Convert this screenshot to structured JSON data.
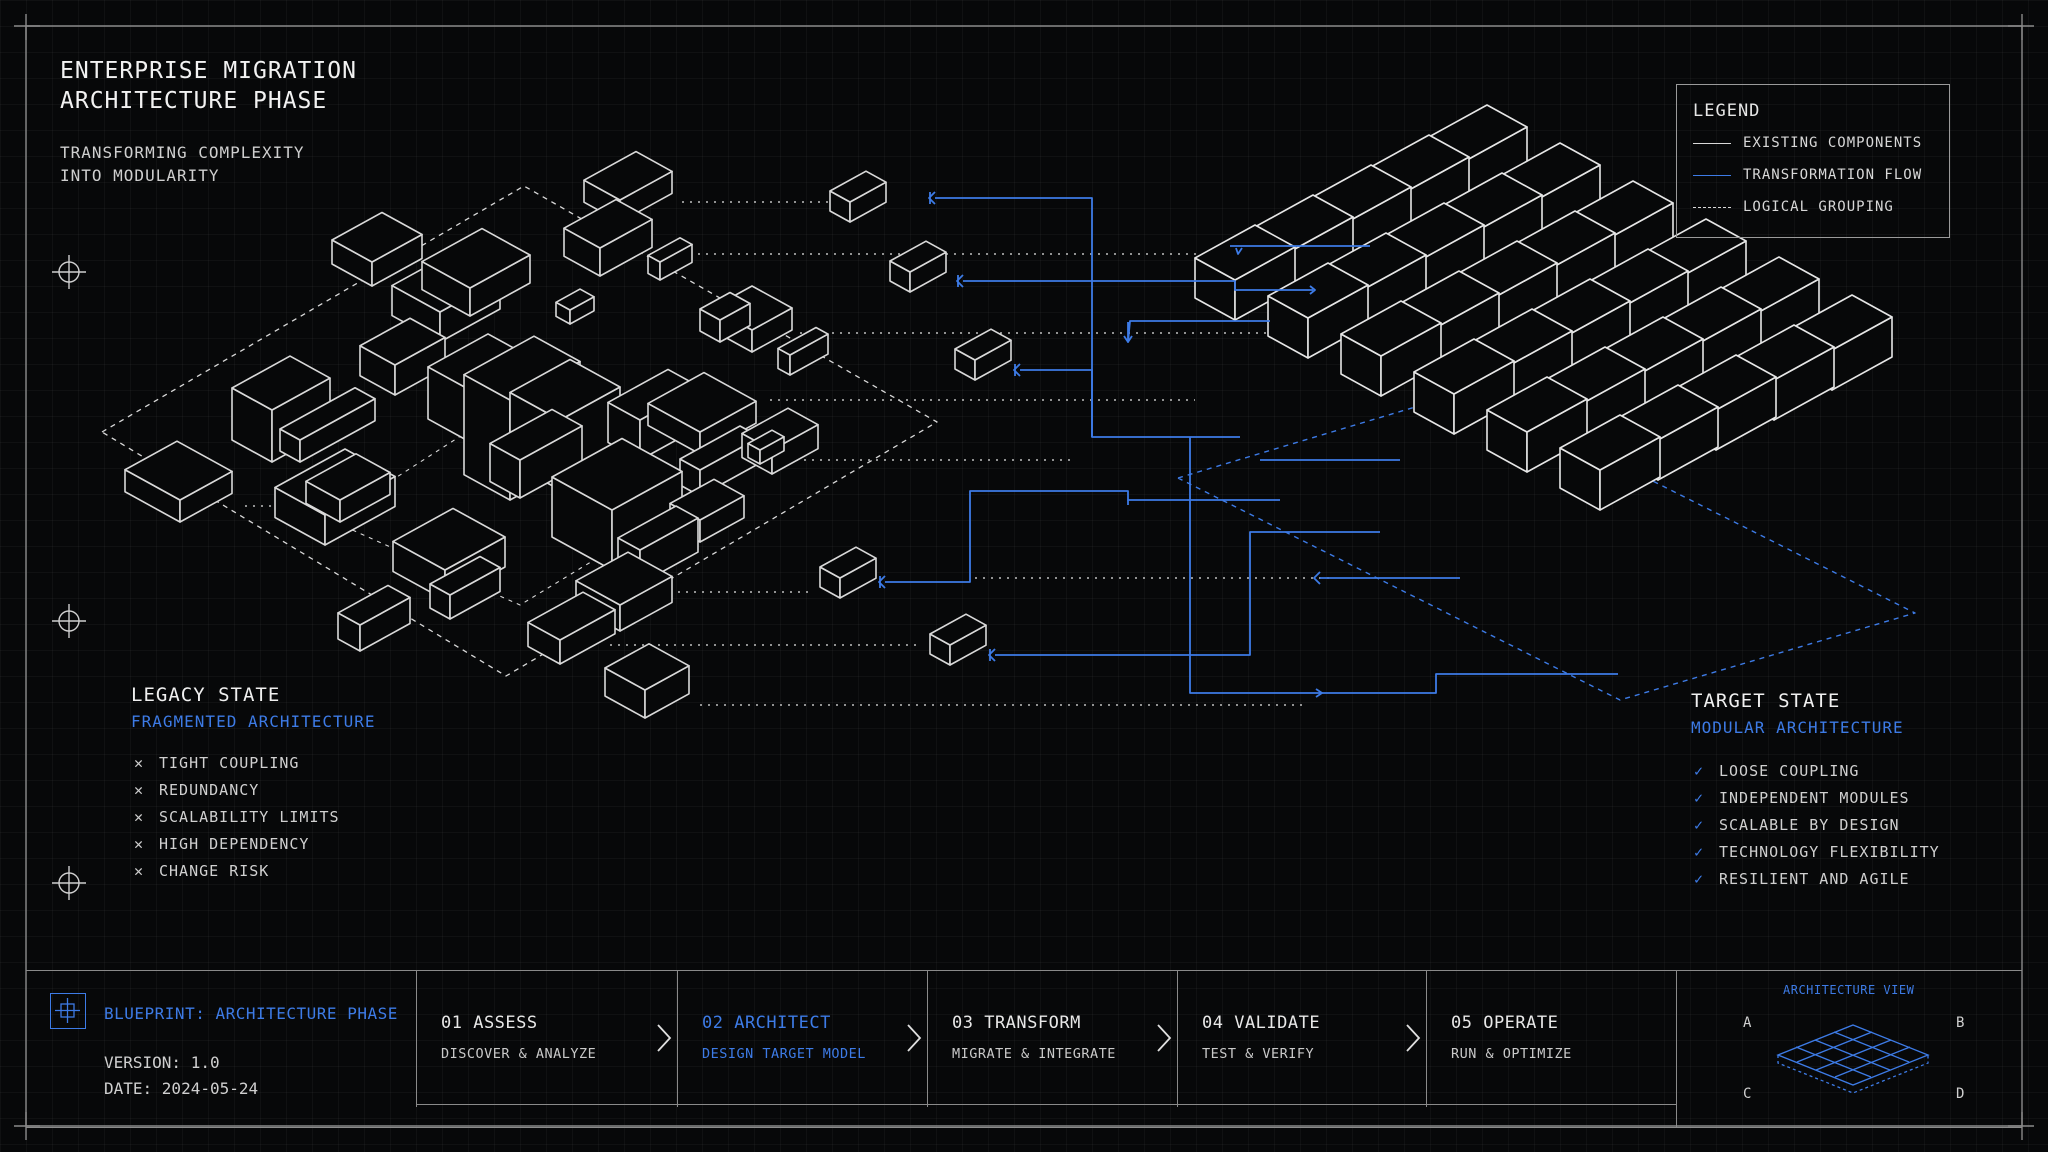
{
  "header": {
    "title_lines": [
      "ENTERPRISE MIGRATION",
      "ARCHITECTURE PHASE"
    ],
    "subtitle_lines": [
      "TRANSFORMING COMPLEXITY",
      "INTO MODULARITY"
    ]
  },
  "legend": {
    "title": "LEGEND",
    "items": [
      {
        "label": "EXISTING COMPONENTS",
        "style": "solid",
        "color": "#d9d9d9"
      },
      {
        "label": "TRANSFORMATION FLOW",
        "style": "solid",
        "color": "#3d7be6"
      },
      {
        "label": "LOGICAL GROUPING",
        "style": "dashed",
        "color": "#d9d9d9"
      }
    ]
  },
  "legacy": {
    "title": "LEGACY STATE",
    "subtitle": "FRAGMENTED ARCHITECTURE",
    "items": [
      "TIGHT COUPLING",
      "REDUNDANCY",
      "SCALABILITY LIMITS",
      "HIGH DEPENDENCY",
      "CHANGE RISK"
    ]
  },
  "target": {
    "title": "TARGET STATE",
    "subtitle": "MODULAR ARCHITECTURE",
    "items": [
      "LOOSE COUPLING",
      "INDEPENDENT MODULES",
      "SCALABLE BY DESIGN",
      "TECHNOLOGY FLEXIBILITY",
      "RESILIENT AND AGILE"
    ]
  },
  "footer": {
    "blueprint_title": "BLUEPRINT: ARCHITECTURE PHASE",
    "version": "VERSION: 1.0",
    "date": "DATE: 2024-05-24",
    "steps": [
      {
        "label": "01 ASSESS",
        "desc": "DISCOVER & ANALYZE",
        "active": false
      },
      {
        "label": "02 ARCHITECT",
        "desc": "DESIGN TARGET MODEL",
        "active": true
      },
      {
        "label": "03 TRANSFORM",
        "desc": "MIGRATE & INTEGRATE",
        "active": false
      },
      {
        "label": "04 VALIDATE",
        "desc": "TEST & VERIFY",
        "active": false
      },
      {
        "label": "05 OPERATE",
        "desc": "RUN & OPTIMIZE",
        "active": false
      }
    ],
    "arch_view": {
      "title": "ARCHITECTURE VIEW",
      "corners": [
        "A",
        "B",
        "C",
        "D"
      ]
    }
  },
  "colors": {
    "accent": "#3d7be6",
    "line": "#d9d9d9",
    "background": "#070809"
  },
  "icons": [
    "crosshair-icon",
    "x-icon",
    "check-icon",
    "chevron-right-icon",
    "blueprint-icon",
    "isometric-grid-icon"
  ]
}
